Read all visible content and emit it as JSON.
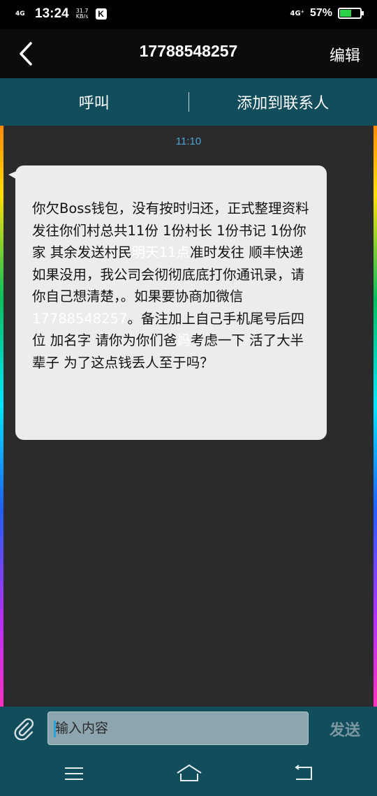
{
  "status_bar": {
    "signal": "4G",
    "time": "13:24",
    "speed_value": "31.7",
    "speed_unit": "KB/s",
    "app_badge": "K",
    "network": "4G⁺",
    "battery_percent": "57%",
    "battery_level": 0.57,
    "battery_color": "#2bd24a"
  },
  "header": {
    "title": "17788548257",
    "edit_label": "编辑",
    "back_icon": "back-chevron-icon"
  },
  "actions": {
    "call_label": "呼叫",
    "add_contact_label": "添加到联系人"
  },
  "conversation": {
    "timestamp": "11:10",
    "message": {
      "p1": " 你欠Boss钱包，没有按时归还，正式整理资料发往你们村总共11份  1份村长  1份书记  1份你家   其余发送村民",
      "link_time": "明天11点",
      "p2": "准时发往 顺丰快递 如果没用，我公司会彻彻底底打你通讯录，请你自己想清楚，。如果要协商加微信",
      "link_phone": "17788548257",
      "p3": "。备注加上自己手机尾号后四位 加名字 请你为你们爸",
      "link_ma": "妈",
      "p4": "考虑一下 活了大半辈子 为了这点钱丢人至于吗？"
    }
  },
  "composer": {
    "placeholder": "输入内容",
    "send_label": "发送",
    "attach_icon": "paperclip-icon"
  },
  "navigation": {
    "menu_icon": "menu-icon",
    "home_icon": "home-icon",
    "back_icon": "back-icon"
  },
  "colors": {
    "action_bar": "#124d5c",
    "chat_background": "#2b2b2b",
    "bubble": "#ececec",
    "timestamp": "#4aa6d6"
  }
}
